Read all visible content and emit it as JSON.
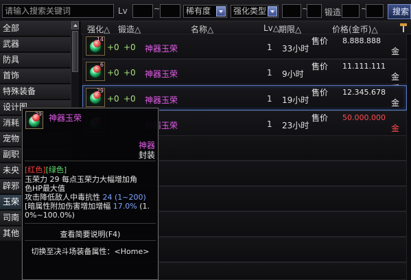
{
  "search": {
    "placeholder": "请输入搜索关键词"
  },
  "filters": {
    "lv_label": "Lv",
    "tilde": "~",
    "rarity": "稀有度",
    "enhance_type": "强化类型",
    "forge_label": "锻造",
    "search_button": "搜索"
  },
  "categories": [
    "全部",
    "武器",
    "防具",
    "首饰",
    "特殊装备",
    "设计图",
    "消耗",
    "宠物",
    "副职",
    "未央",
    "辟邪",
    "玉荣",
    "司南",
    "其他"
  ],
  "selected_category_index": 11,
  "columns": [
    "强化△",
    "锻造△",
    "名称△",
    "Lv△",
    "期限△",
    "价格(金币)△"
  ],
  "items": [
    {
      "enhance": "+0",
      "forge": "+0",
      "name": "神器玉荣",
      "lv": "1",
      "period": "33小时",
      "price_label": "售价",
      "price": "8.888.888",
      "currency": "金币",
      "icon_level": "14",
      "price_red": false
    },
    {
      "enhance": "+0",
      "forge": "+0",
      "name": "神器玉荣",
      "lv": "1",
      "period": "9小时",
      "price_label": "售价",
      "price": "11.111.111",
      "currency": "金币",
      "icon_level": "6",
      "price_red": false
    },
    {
      "enhance": "+0",
      "forge": "+0",
      "name": "神器玉荣",
      "lv": "1",
      "period": "19小时",
      "price_label": "售价",
      "price": "12.345.678",
      "currency": "金币",
      "icon_level": "29",
      "price_red": false
    },
    {
      "enhance": "",
      "forge": "",
      "name": "神器玉荣",
      "lv": "1",
      "period": "23小时",
      "price_label": "售价",
      "price": "50.000.000",
      "currency": "金币",
      "icon_level": "",
      "price_red": true
    }
  ],
  "tooltip": {
    "icon_level": "29",
    "title": "神器玉荣",
    "grade": "神器",
    "seal": "封装",
    "colors_red": "[红色]",
    "colors_green": "[绿色]",
    "line1": "玉荣力 29 每点玉荣力大幅增加角",
    "line2": "色HP最大值",
    "line3_a": "攻击降低敌人中毒抗性",
    "line3_b": "24 (1~200)",
    "line4_a": "[暗属性附加伤害增加增幅",
    "line4_b": "17.0%",
    "line4_c": "(1.",
    "line5": "0%~100.0%)",
    "btn_brief": "查看简要说明(F4)",
    "btn_switch": "切换至决斗场装备属性：<Home>"
  }
}
